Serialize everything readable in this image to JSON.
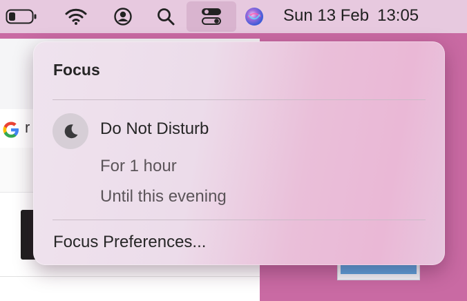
{
  "menubar": {
    "icons": {
      "battery": "battery-icon",
      "wifi": "wifi-icon",
      "user": "user-account-icon",
      "search": "spotlight-search-icon",
      "control_center": "control-center-icon",
      "siri": "siri-icon"
    },
    "date": "Sun 13 Feb",
    "time": "13:05"
  },
  "background": {
    "search_fragment": "r",
    "google_icon": "google-icon"
  },
  "focus_popover": {
    "title": "Focus",
    "do_not_disturb": {
      "label": "Do Not Disturb",
      "icon": "moon-icon",
      "options": [
        "For 1 hour",
        "Until this evening"
      ]
    },
    "preferences_label": "Focus Preferences..."
  },
  "colors": {
    "menubar_bg": "#e7c9df",
    "desktop_bg": "#c96aa3",
    "text_primary": "#262626",
    "text_secondary": "#5b5459"
  }
}
